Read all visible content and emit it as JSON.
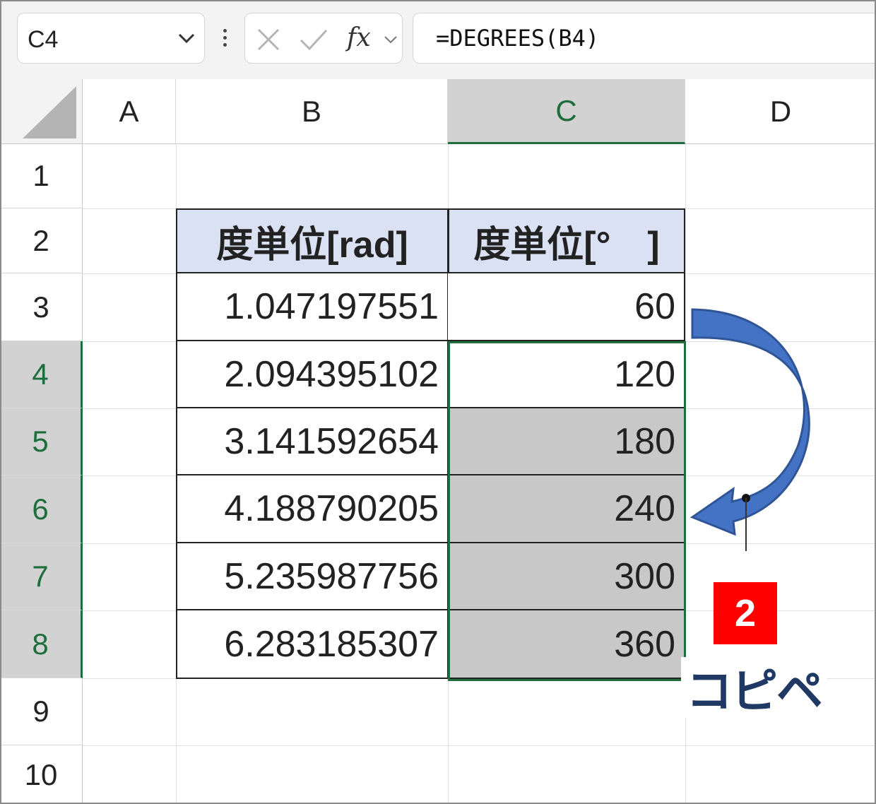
{
  "formula_bar": {
    "name_box": "C4",
    "formula": "=DEGREES(B4)",
    "fx_label": "fx",
    "icons": [
      "chevron-down-icon",
      "more-icon",
      "cancel-icon",
      "enter-icon",
      "function-icon"
    ]
  },
  "columns": [
    "A",
    "B",
    "C",
    "D"
  ],
  "selected_column": "C",
  "rows": [
    "1",
    "2",
    "3",
    "4",
    "5",
    "6",
    "7",
    "8",
    "9",
    "10"
  ],
  "selected_rows": [
    "4",
    "5",
    "6",
    "7",
    "8"
  ],
  "table": {
    "header_b": "度単位[rad]",
    "header_c": "度単位[°　]",
    "radians": [
      "1.047197551",
      "2.094395102",
      "3.141592654",
      "4.188790205",
      "5.235987756",
      "6.283185307"
    ],
    "degrees": [
      "60",
      "120",
      "180",
      "240",
      "300",
      "360"
    ]
  },
  "annotation": {
    "step_number": "2",
    "label": "コピペ",
    "arrow": "curved-down-arrow-icon",
    "colors": {
      "badge": "#ff0000",
      "label": "#1f3864",
      "arrow": "#4472c4"
    }
  },
  "colors": {
    "selection": "#1e6e3c",
    "header_fill": "#d9e1f2",
    "selected_fill": "#c8c8c8"
  }
}
